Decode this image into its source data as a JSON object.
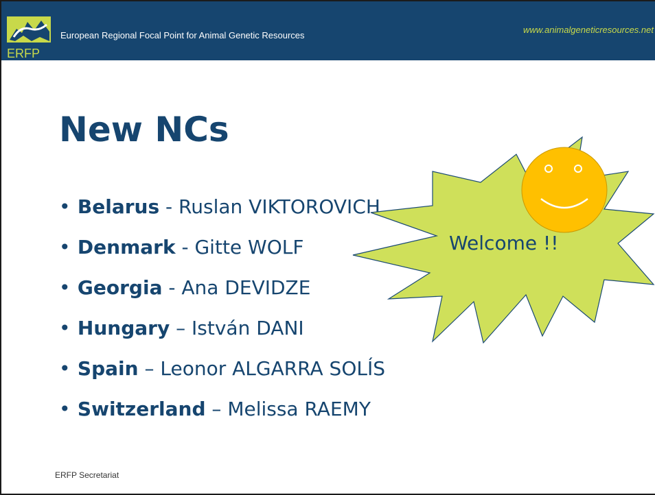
{
  "header": {
    "logo_text": "ERFP",
    "org_name": "European Regional Focal Point for Animal Genetic Resources",
    "website": "www.animalgeneticresources.net"
  },
  "slide": {
    "title": "New NCs",
    "bullets": [
      {
        "country": "Belarus",
        "separator": " - ",
        "name": "Ruslan VIKTOROVICH"
      },
      {
        "country": "Denmark",
        "separator": " - ",
        "name": "Gitte WOLF"
      },
      {
        "country": "Georgia",
        "separator": " - ",
        "name": "Ana DEVIDZE"
      },
      {
        "country": "Hungary",
        "separator": " – ",
        "name": "István DANI"
      },
      {
        "country": "Spain",
        "separator": " – ",
        "name": "Leonor ALGARRA SOLÍS"
      },
      {
        "country": "Switzerland",
        "separator": " – ",
        "name": "Melissa RAEMY"
      }
    ],
    "callout": {
      "text": "Welcome !!",
      "star_color": "#cfe05a",
      "smiley_icon": "smiley-face-icon",
      "smiley_color": "#ffc000"
    }
  },
  "footer": {
    "text": "ERFP Secretariat"
  },
  "colors": {
    "header_bg": "#16456f",
    "accent": "#c8d94a",
    "text": "#16456f"
  }
}
